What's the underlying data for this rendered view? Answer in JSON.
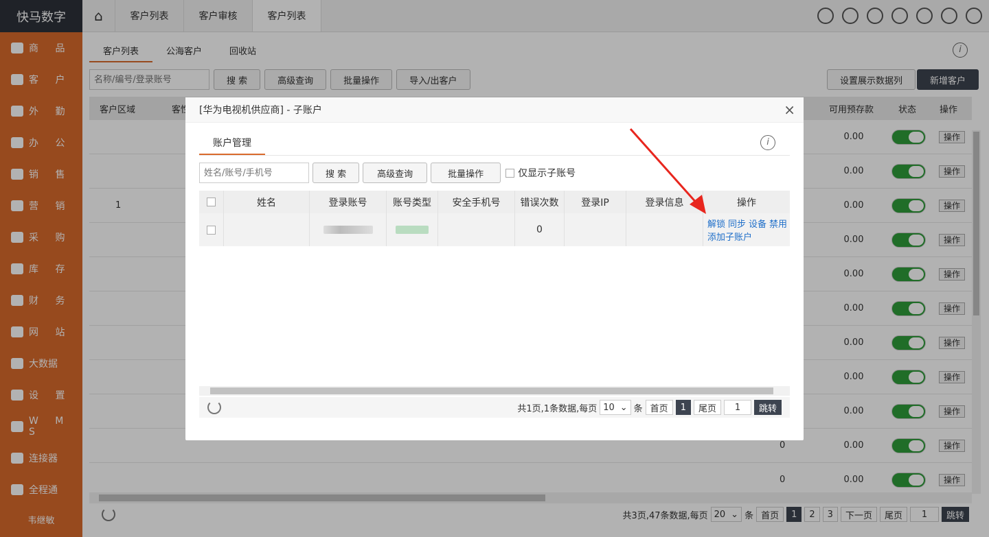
{
  "sidebar": {
    "logo": "快马数字",
    "items": [
      {
        "label": "商 品",
        "icon": "product-icon"
      },
      {
        "label": "客 户",
        "icon": "customer-icon"
      },
      {
        "label": "外 勤",
        "icon": "field-icon"
      },
      {
        "label": "办 公",
        "icon": "office-icon"
      },
      {
        "label": "销 售",
        "icon": "sales-tag-icon"
      },
      {
        "label": "营 销",
        "icon": "marketing-chart-icon"
      },
      {
        "label": "采 购",
        "icon": "cart-icon"
      },
      {
        "label": "库 存",
        "icon": "warehouse-icon"
      },
      {
        "label": "财 务",
        "icon": "money-bag-icon"
      },
      {
        "label": "网 站",
        "icon": "monitor-icon"
      },
      {
        "label": "大数据",
        "icon": "pie-chart-icon"
      },
      {
        "label": "设 置",
        "icon": "gear-icon"
      },
      {
        "label": "W M S",
        "icon": "wms-icon"
      },
      {
        "label": "连接器",
        "icon": "link-icon"
      },
      {
        "label": "全程通",
        "icon": "sync-arrows-icon"
      }
    ],
    "user": "韦继敏"
  },
  "topbar": {
    "tabs": [
      "客户列表",
      "客户审核",
      "客户列表"
    ],
    "active_tab": 2
  },
  "subtabs": [
    "客户列表",
    "公海客户",
    "回收站"
  ],
  "toolbar": {
    "search_placeholder": "名称/编号/登录账号",
    "search": "搜 索",
    "advanced": "高级查询",
    "batch": "批量操作",
    "import_export": "导入/出客户",
    "display_cols": "设置展示数据列",
    "add_customer": "新增客户"
  },
  "bg_table": {
    "headers": {
      "region": "客户区域",
      "col2": "客性",
      "deposit": "可用预存款",
      "status": "状态",
      "op": "操作"
    },
    "first_row_region": "1",
    "rows_amount": [
      "0.00",
      "0.00",
      "0.00",
      "0.00",
      "0.00",
      "0.00",
      "0.00",
      "0.00",
      "0.00",
      "0.00",
      "0.00"
    ],
    "row_op": "操作",
    "extra_zero": "0"
  },
  "bg_pager": {
    "summary": "共3页,47条数据,每页",
    "per_page": "20",
    "unit": "条",
    "first": "首页",
    "pages": [
      "1",
      "2",
      "3"
    ],
    "next": "下一页",
    "last": "尾页",
    "goto_value": "1",
    "goto": "跳转"
  },
  "modal": {
    "title": "[华为电视机供应商] - 子账户",
    "close": "×",
    "tab": "账户管理",
    "search_placeholder": "姓名/账号/手机号",
    "search": "搜 索",
    "advanced": "高级查询",
    "batch": "批量操作",
    "only_sub": "仅显示子账号",
    "headers": [
      "姓名",
      "登录账号",
      "账号类型",
      "安全手机号",
      "错误次数",
      "登录IP",
      "登录信息",
      "操作"
    ],
    "row": {
      "error_count": "0",
      "actions": [
        "解锁",
        "同步",
        "设备",
        "禁用"
      ],
      "add_sub": "添加子账户"
    },
    "pager": {
      "summary": "共1页,1条数据,每页",
      "per_page": "10",
      "unit": "条",
      "first": "首页",
      "page": "1",
      "last": "尾页",
      "goto_value": "1",
      "goto": "跳转"
    }
  },
  "colors": {
    "accent": "#d96a2c",
    "dark": "#3d4450",
    "toggle_on": "#2e9c3a",
    "link": "#1f6fc9",
    "arrow": "#e8261e"
  }
}
